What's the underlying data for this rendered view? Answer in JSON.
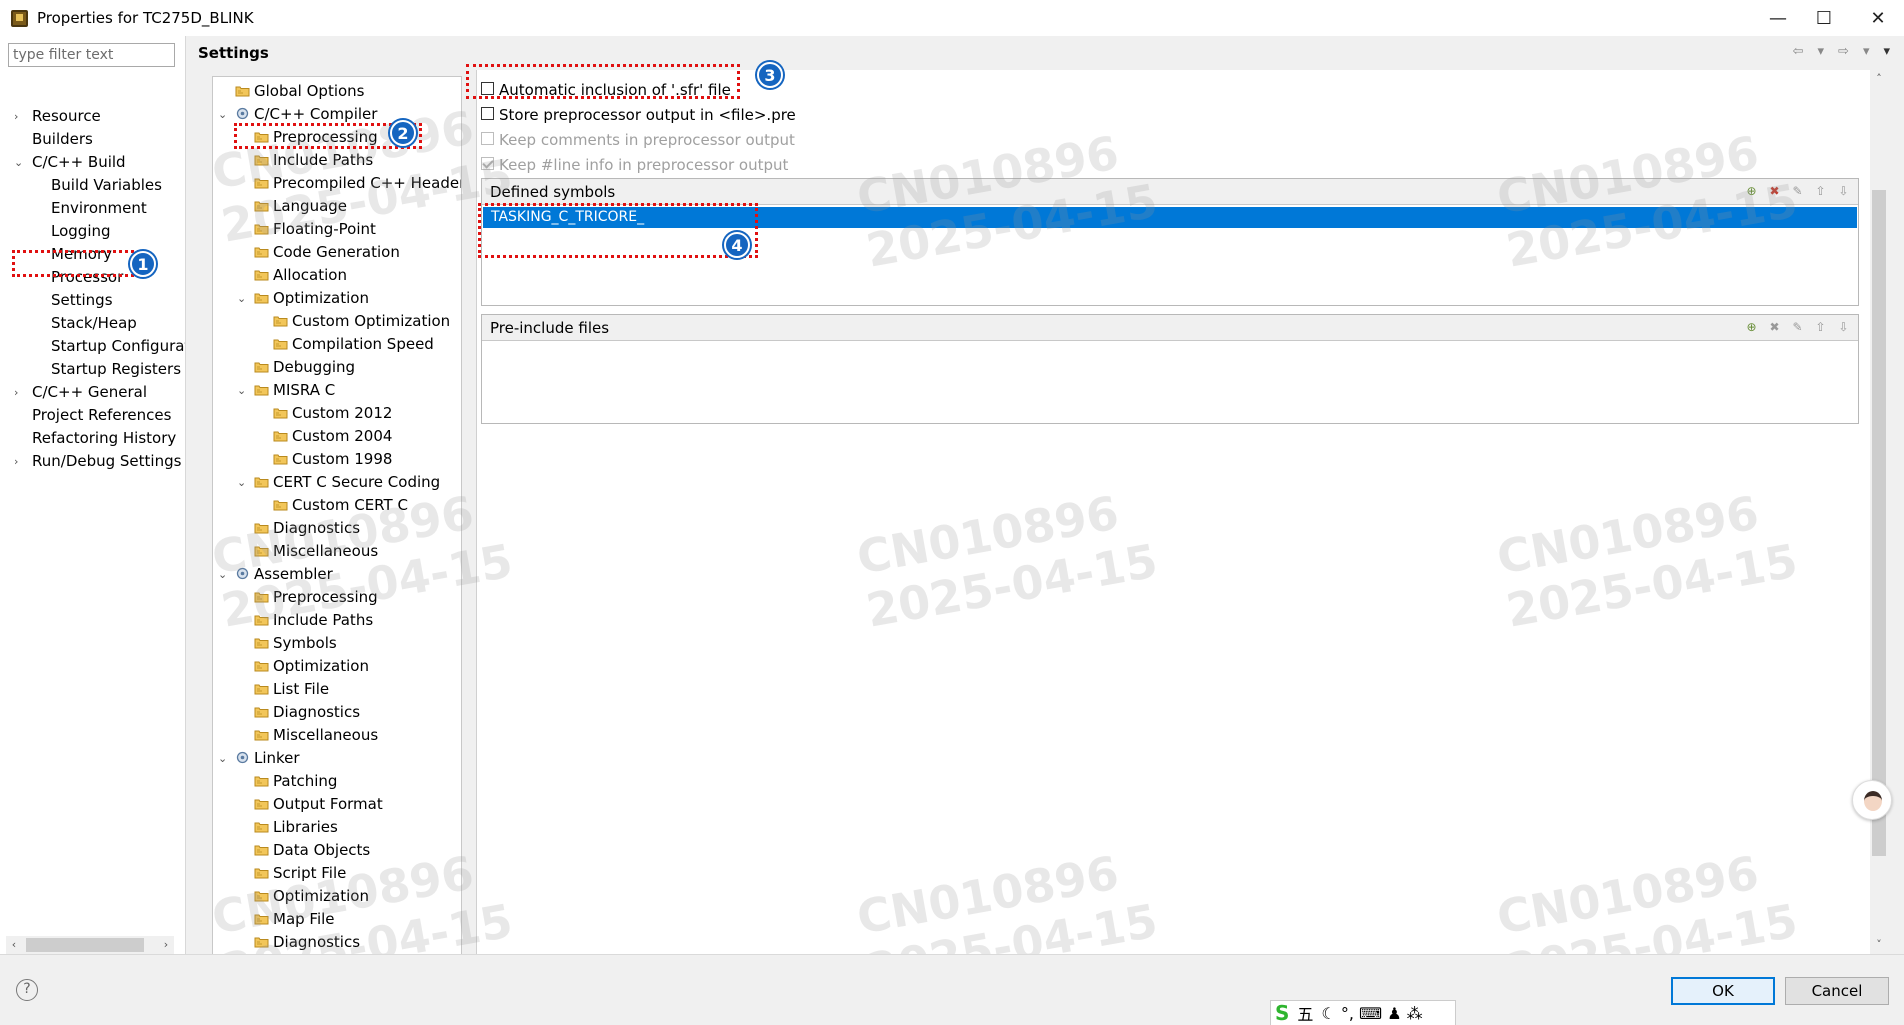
{
  "window": {
    "title": "Properties for TC275D_BLINK",
    "minimize": "—",
    "maximize": "☐",
    "close": "✕"
  },
  "left": {
    "filter_placeholder": "type filter text",
    "items": [
      {
        "label": "Resource",
        "level": 0,
        "twisty": "›"
      },
      {
        "label": "Builders",
        "level": 0,
        "twisty": ""
      },
      {
        "label": "C/C++ Build",
        "level": 0,
        "twisty": "⌄"
      },
      {
        "label": "Build Variables",
        "level": 1,
        "twisty": ""
      },
      {
        "label": "Environment",
        "level": 1,
        "twisty": ""
      },
      {
        "label": "Logging",
        "level": 1,
        "twisty": ""
      },
      {
        "label": "Memory",
        "level": 1,
        "twisty": ""
      },
      {
        "label": "Processor",
        "level": 1,
        "twisty": ""
      },
      {
        "label": "Settings",
        "level": 1,
        "twisty": ""
      },
      {
        "label": "Stack/Heap",
        "level": 1,
        "twisty": ""
      },
      {
        "label": "Startup Configurat",
        "level": 1,
        "twisty": ""
      },
      {
        "label": "Startup Registers",
        "level": 1,
        "twisty": ""
      },
      {
        "label": "C/C++ General",
        "level": 0,
        "twisty": "›"
      },
      {
        "label": "Project References",
        "level": 0,
        "twisty": ""
      },
      {
        "label": "Refactoring History",
        "level": 0,
        "twisty": ""
      },
      {
        "label": "Run/Debug Settings",
        "level": 0,
        "twisty": "›"
      }
    ]
  },
  "settings": {
    "title": "Settings",
    "tool_tree": [
      {
        "label": "Global Options",
        "level": 0,
        "twisty": "",
        "icon": "folder"
      },
      {
        "label": "C/C++ Compiler",
        "level": 0,
        "twisty": "⌄",
        "icon": "gear"
      },
      {
        "label": "Preprocessing",
        "level": 1,
        "twisty": "",
        "icon": "folder"
      },
      {
        "label": "Include Paths",
        "level": 1,
        "twisty": "",
        "icon": "folder"
      },
      {
        "label": "Precompiled C++ Headers",
        "level": 1,
        "twisty": "",
        "icon": "folder"
      },
      {
        "label": "Language",
        "level": 1,
        "twisty": "",
        "icon": "folder"
      },
      {
        "label": "Floating-Point",
        "level": 1,
        "twisty": "",
        "icon": "folder"
      },
      {
        "label": "Code Generation",
        "level": 1,
        "twisty": "",
        "icon": "folder"
      },
      {
        "label": "Allocation",
        "level": 1,
        "twisty": "",
        "icon": "folder"
      },
      {
        "label": "Optimization",
        "level": 1,
        "twisty": "⌄",
        "icon": "folder"
      },
      {
        "label": "Custom Optimization",
        "level": 2,
        "twisty": "",
        "icon": "folder"
      },
      {
        "label": "Compilation Speed",
        "level": 2,
        "twisty": "",
        "icon": "folder"
      },
      {
        "label": "Debugging",
        "level": 1,
        "twisty": "",
        "icon": "folder"
      },
      {
        "label": "MISRA C",
        "level": 1,
        "twisty": "⌄",
        "icon": "folder"
      },
      {
        "label": "Custom 2012",
        "level": 2,
        "twisty": "",
        "icon": "folder"
      },
      {
        "label": "Custom 2004",
        "level": 2,
        "twisty": "",
        "icon": "folder"
      },
      {
        "label": "Custom 1998",
        "level": 2,
        "twisty": "",
        "icon": "folder"
      },
      {
        "label": "CERT C Secure Coding",
        "level": 1,
        "twisty": "⌄",
        "icon": "folder"
      },
      {
        "label": "Custom CERT C",
        "level": 2,
        "twisty": "",
        "icon": "folder"
      },
      {
        "label": "Diagnostics",
        "level": 1,
        "twisty": "",
        "icon": "folder"
      },
      {
        "label": "Miscellaneous",
        "level": 1,
        "twisty": "",
        "icon": "folder"
      },
      {
        "label": "Assembler",
        "level": 0,
        "twisty": "⌄",
        "icon": "gear"
      },
      {
        "label": "Preprocessing",
        "level": 1,
        "twisty": "",
        "icon": "folder"
      },
      {
        "label": "Include Paths",
        "level": 1,
        "twisty": "",
        "icon": "folder"
      },
      {
        "label": "Symbols",
        "level": 1,
        "twisty": "",
        "icon": "folder"
      },
      {
        "label": "Optimization",
        "level": 1,
        "twisty": "",
        "icon": "folder"
      },
      {
        "label": "List File",
        "level": 1,
        "twisty": "",
        "icon": "folder"
      },
      {
        "label": "Diagnostics",
        "level": 1,
        "twisty": "",
        "icon": "folder"
      },
      {
        "label": "Miscellaneous",
        "level": 1,
        "twisty": "",
        "icon": "folder"
      },
      {
        "label": "Linker",
        "level": 0,
        "twisty": "⌄",
        "icon": "gear"
      },
      {
        "label": "Patching",
        "level": 1,
        "twisty": "",
        "icon": "folder"
      },
      {
        "label": "Output Format",
        "level": 1,
        "twisty": "",
        "icon": "folder"
      },
      {
        "label": "Libraries",
        "level": 1,
        "twisty": "",
        "icon": "folder"
      },
      {
        "label": "Data Objects",
        "level": 1,
        "twisty": "",
        "icon": "folder"
      },
      {
        "label": "Script File",
        "level": 1,
        "twisty": "",
        "icon": "folder"
      },
      {
        "label": "Optimization",
        "level": 1,
        "twisty": "",
        "icon": "folder"
      },
      {
        "label": "Map File",
        "level": 1,
        "twisty": "",
        "icon": "folder"
      },
      {
        "label": "Diagnostics",
        "level": 1,
        "twisty": "",
        "icon": "folder"
      }
    ],
    "options": {
      "auto_sfr": "Automatic inclusion of '.sfr' file",
      "store_pre": "Store preprocessor output in <file>.pre",
      "keep_comments": "Keep comments in preprocessor output",
      "keep_line": "Keep #line info in preprocessor output"
    },
    "defined_symbols": {
      "title": "Defined symbols",
      "items": [
        "TASKING_C_TRICORE_"
      ]
    },
    "preinclude": {
      "title": "Pre-include files"
    }
  },
  "annotations": [
    "1",
    "2",
    "3",
    "4"
  ],
  "watermark": {
    "line1": "CN010896",
    "line2": "2025-04-15"
  },
  "buttons": {
    "ok": "OK",
    "cancel": "Cancel",
    "help": "?"
  },
  "ime": {
    "logo": "S",
    "mode": "五",
    "icons": "☾ °, ⌨ ♟ ⁂"
  },
  "colors": {
    "selection": "#0078d7",
    "annotation_red": "#e01010",
    "badge_blue": "#1565c0"
  }
}
